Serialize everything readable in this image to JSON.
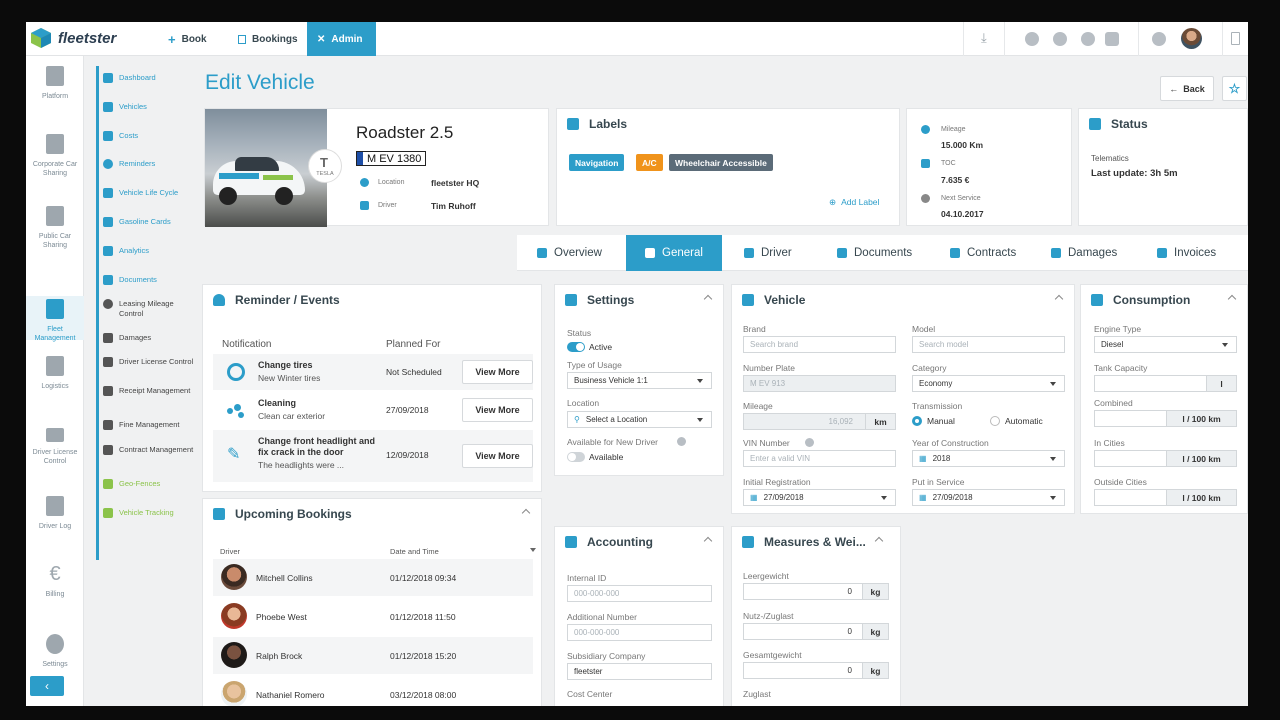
{
  "app": {
    "name": "fleetster"
  },
  "topnav": {
    "book": "Book",
    "bookings": "Bookings",
    "admin": "Admin"
  },
  "rail": [
    "Platform",
    "Corporate Car Sharing",
    "Public Car Sharing",
    "Fleet Management",
    "Logistics",
    "Driver License Control",
    "Driver Log",
    "Billing",
    "Settings"
  ],
  "submenu": [
    "Dashboard",
    "Vehicles",
    "Costs",
    "Reminders",
    "Vehicle Life Cycle",
    "Gasoline Cards",
    "Analytics",
    "Documents",
    "Leasing Mileage Control",
    "Damages",
    "Driver License Control",
    "Receipt Management",
    "Fine Management",
    "Contract Management",
    "Geo-Fences",
    "Vehicle Tracking"
  ],
  "page": {
    "title": "Edit Vehicle",
    "back": "Back"
  },
  "vehicle": {
    "name": "Roadster 2.5",
    "plate": "M EV 1380",
    "location_label": "Location",
    "location": "fleetster HQ",
    "driver_label": "Driver",
    "driver": "Tim Ruhoff",
    "brand_badge": "TESLA"
  },
  "labels": {
    "title": "Labels",
    "items": [
      {
        "text": "Navigation",
        "color": "#2c9dc9"
      },
      {
        "text": "A/C",
        "color": "#f0931b"
      },
      {
        "text": "Wheelchair Accessible",
        "color": "#5b6b78"
      }
    ],
    "add": "Add Label"
  },
  "stats": {
    "mileage_label": "Mileage",
    "mileage": "15.000 Km",
    "toc_label": "TOC",
    "toc": "7.635 €",
    "service_label": "Next Service",
    "service": "04.10.2017"
  },
  "status": {
    "title": "Status",
    "telematics_label": "Telematics",
    "telematics": "Last update: 3h 5m"
  },
  "tabs": [
    "Overview",
    "General",
    "Driver",
    "Documents",
    "Contracts",
    "Damages",
    "Invoices"
  ],
  "reminders": {
    "title": "Reminder / Events",
    "col1": "Notification",
    "col2": "Planned For",
    "action": "View More",
    "rows": [
      {
        "title": "Change tires",
        "sub": "New Winter tires",
        "date": "Not Scheduled"
      },
      {
        "title": "Cleaning",
        "sub": "Clean car exterior",
        "date": "27/09/2018"
      },
      {
        "title": "Change front headlight and fix crack in the door",
        "sub": "The headlights were ...",
        "date": "12/09/2018"
      }
    ]
  },
  "bookings": {
    "title": "Upcoming Bookings",
    "col1": "Driver",
    "col2": "Date and Time",
    "rows": [
      {
        "name": "Mitchell Collins",
        "date": "01/12/2018 09:34"
      },
      {
        "name": "Phoebe West",
        "date": "01/12/2018 11:50"
      },
      {
        "name": "Ralph Brock",
        "date": "01/12/2018 15:20"
      },
      {
        "name": "Nathaniel Romero",
        "date": "03/12/2018 08:00"
      }
    ]
  },
  "settings": {
    "title": "Settings",
    "status_label": "Status",
    "status": "Active",
    "usage_label": "Type of Usage",
    "usage": "Business Vehicle 1:1",
    "location_label": "Location",
    "location": "Select a Location",
    "available_label": "Available for New Driver",
    "available": "Available"
  },
  "accounting": {
    "title": "Accounting",
    "internal_label": "Internal ID",
    "internal_ph": "000-000-000",
    "additional_label": "Additional Number",
    "additional_ph": "000-000-000",
    "subsidiary_label": "Subsidiary Company",
    "subsidiary": "fleetster",
    "cost_label": "Cost Center"
  },
  "vehicle_form": {
    "title": "Vehicle",
    "brand_label": "Brand",
    "brand_ph": "Search brand",
    "model_label": "Model",
    "model_ph": "Search model",
    "plate_label": "Number Plate",
    "plate": "M EV 913",
    "category_label": "Category",
    "category": "Economy",
    "mileage_label": "Mileage",
    "mileage": "16,092",
    "mileage_unit": "km",
    "transmission_label": "Transmission",
    "manual": "Manual",
    "automatic": "Automatic",
    "vin_label": "VIN Number",
    "vin_ph": "Enter a valid VIN",
    "year_label": "Year of Construction",
    "year": "2018",
    "reg_label": "Initial Registration",
    "reg": "27/09/2018",
    "service_label": "Put in Service",
    "service": "27/09/2018"
  },
  "measures": {
    "title": "Measures & Wei...",
    "rows": [
      {
        "label": "Leergewicht",
        "value": "0",
        "unit": "kg"
      },
      {
        "label": "Nutz-/Zuglast",
        "value": "0",
        "unit": "kg"
      },
      {
        "label": "Gesamtgewicht",
        "value": "0",
        "unit": "kg"
      },
      {
        "label": "Zuglast"
      }
    ]
  },
  "consumption": {
    "title": "Consumption",
    "engine_label": "Engine Type",
    "engine": "Diesel",
    "tank_label": "Tank Capacity",
    "tank_unit": "l",
    "combined_label": "Combined",
    "incities_label": "In Cities",
    "outside_label": "Outside Cities",
    "unit": "l / 100 km"
  }
}
